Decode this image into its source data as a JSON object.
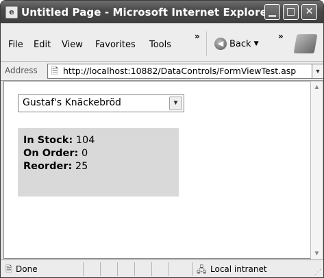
{
  "window": {
    "title": "Untitled Page - Microsoft Internet Explorer",
    "controls": {
      "minimize": "▁",
      "maximize": "□",
      "close": "✕"
    }
  },
  "menu": {
    "items": [
      "File",
      "Edit",
      "View",
      "Favorites",
      "Tools"
    ],
    "overflow": "»",
    "back_label": "Back"
  },
  "address": {
    "label": "Address",
    "url": "http://localhost:10882/DataControls/FormViewTest.asp"
  },
  "page": {
    "selected_product": "Gustaf's Knäckebröd",
    "stock": {
      "in_stock_label": "In Stock:",
      "in_stock_value": "104",
      "on_order_label": "On Order:",
      "on_order_value": "0",
      "reorder_label": "Reorder:",
      "reorder_value": "25"
    }
  },
  "status": {
    "text": "Done",
    "zone": "Local intranet"
  },
  "icons": {
    "app": "ie-page-icon",
    "back": "back-arrow-icon",
    "windows_logo": "windows-flag-icon",
    "page": "page-icon",
    "zone": "intranet-icon"
  }
}
